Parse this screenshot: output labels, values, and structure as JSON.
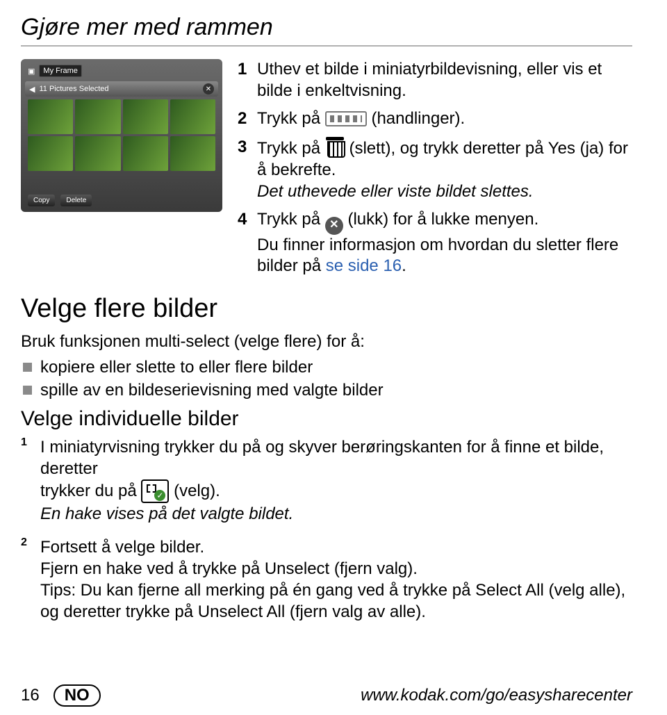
{
  "title": "Gjøre mer med rammen",
  "screenshot": {
    "frame_label": "My Frame",
    "selected_label": "11 Pictures Selected",
    "copy_label": "Copy",
    "delete_label": "Delete"
  },
  "steps_top": {
    "s1": {
      "num": "1",
      "text": "Uthev et bilde i miniatyrbildevisning, eller vis et bilde i enkeltvisning."
    },
    "s2": {
      "num": "2",
      "prefix": "Trykk på ",
      "suffix": " (handlinger)."
    },
    "s3": {
      "num": "3",
      "prefix": "Trykk på ",
      "mid": " (slett), og trykk deretter på Yes (ja) for å bekrefte.",
      "italic": "Det uthevede eller viste bildet slettes."
    },
    "s4": {
      "num": "4",
      "prefix": "Trykk på ",
      "mid": " (lukk) for å lukke menyen.",
      "after": "Du finner informasjon om hvordan du sletter flere bilder på ",
      "link": "se side 16",
      "dot": "."
    }
  },
  "select_section": {
    "heading": "Velge flere bilder",
    "intro": "Bruk funksjonen multi-select (velge flere) for å:",
    "bullets": [
      "kopiere eller slette to eller flere bilder",
      "spille av en bildeserievisning med valgte bilder"
    ],
    "subheading": "Velge individuelle bilder",
    "s1": {
      "num": "1",
      "line1": "I miniatyrvisning trykker du på og skyver berøringskanten for å finne et bilde, deretter",
      "line2_pre": "trykker du på ",
      "line2_post": " (velg).",
      "italic": "En hake vises på det valgte bildet."
    },
    "s2": {
      "num": "2",
      "l1": "Fortsett å velge bilder.",
      "l2": "Fjern en hake ved å trykke på Unselect (fjern valg).",
      "l3": "Tips: Du kan fjerne all merking på én gang ved å trykke på Select All (velg alle), og deretter trykke på Unselect All (fjern valg av alle)."
    }
  },
  "footer": {
    "page": "16",
    "lang": "NO",
    "url": "www.kodak.com/go/easysharecenter"
  }
}
